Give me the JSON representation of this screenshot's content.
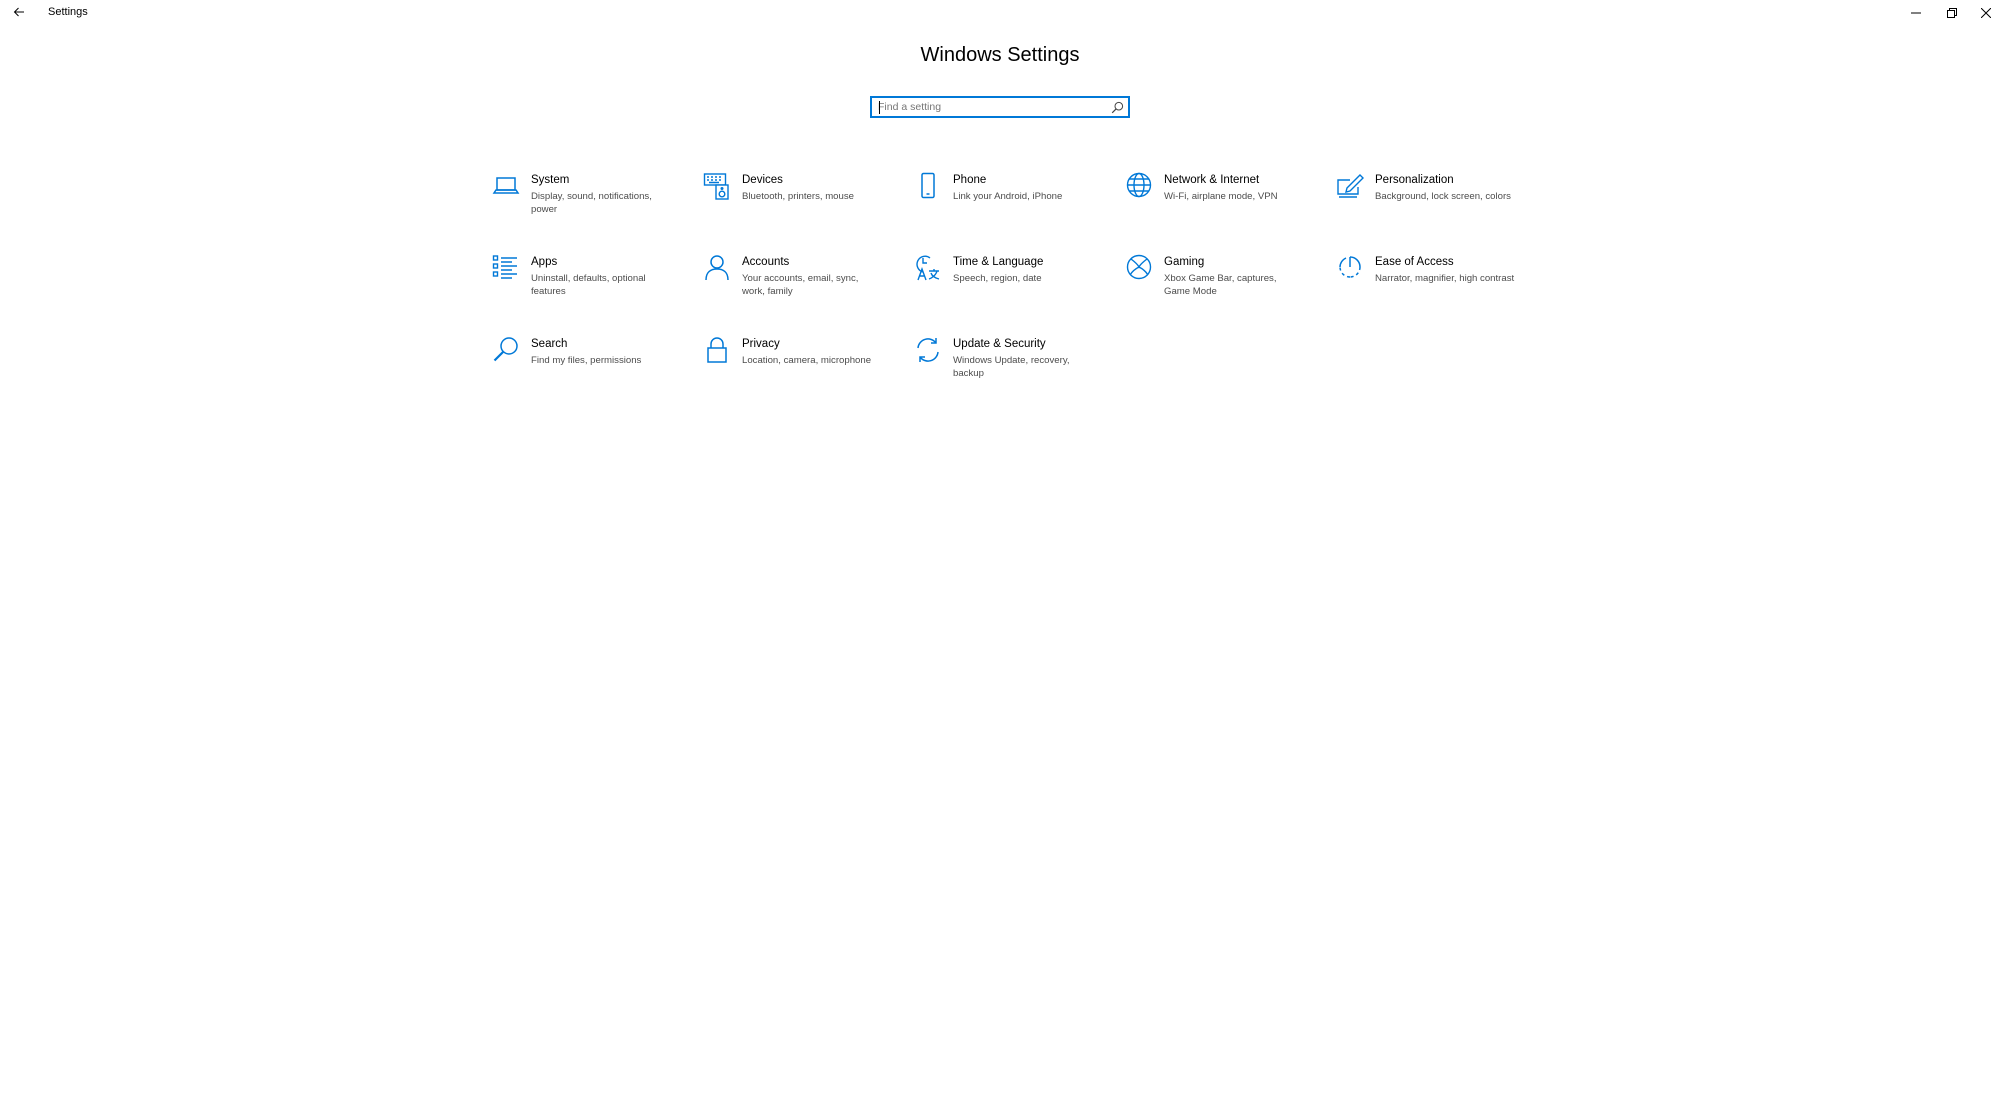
{
  "window": {
    "title": "Settings",
    "back": "back-arrow-icon",
    "controls": [
      "minimize-icon",
      "restore-icon",
      "close-icon"
    ]
  },
  "page": {
    "heading": "Windows Settings",
    "search_placeholder": "Find a setting"
  },
  "accent_color": "#0078d7",
  "categories": [
    {
      "label": "System",
      "description": "Display, sound, notifications, power",
      "icon": "laptop-icon"
    },
    {
      "label": "Devices",
      "description": "Bluetooth, printers, mouse",
      "icon": "keyboard-speaker-icon"
    },
    {
      "label": "Phone",
      "description": "Link your Android, iPhone",
      "icon": "phone-icon"
    },
    {
      "label": "Network & Internet",
      "description": "Wi-Fi, airplane mode, VPN",
      "icon": "globe-icon"
    },
    {
      "label": "Personalization",
      "description": "Background, lock screen, colors",
      "icon": "pen-tablet-icon"
    },
    {
      "label": "Apps",
      "description": "Uninstall, defaults, optional features",
      "icon": "apps-list-icon"
    },
    {
      "label": "Accounts",
      "description": "Your accounts, email, sync, work, family",
      "icon": "person-icon"
    },
    {
      "label": "Time & Language",
      "description": "Speech, region, date",
      "icon": "clock-language-icon"
    },
    {
      "label": "Gaming",
      "description": "Xbox Game Bar, captures, Game Mode",
      "icon": "xbox-icon"
    },
    {
      "label": "Ease of Access",
      "description": "Narrator, magnifier, high contrast",
      "icon": "ease-of-access-icon"
    },
    {
      "label": "Search",
      "description": "Find my files, permissions",
      "icon": "search-icon"
    },
    {
      "label": "Privacy",
      "description": "Location, camera, microphone",
      "icon": "lock-icon"
    },
    {
      "label": "Update & Security",
      "description": "Windows Update, recovery, backup",
      "icon": "sync-icon"
    }
  ]
}
